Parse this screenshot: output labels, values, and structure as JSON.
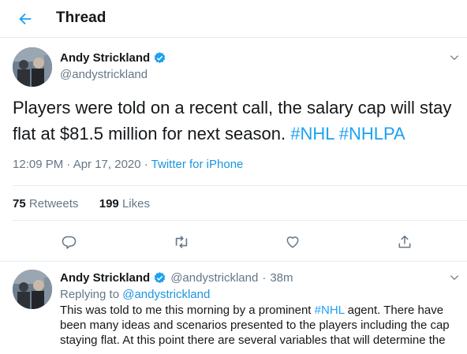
{
  "header": {
    "title": "Thread"
  },
  "main_tweet": {
    "author_name": "Andy Strickland",
    "author_handle": "@andystrickland",
    "text": "Players were told on a recent call, the salary cap will stay flat at $81.5 million for next season. ",
    "hashtags": [
      "#NHL",
      "#NHLPA"
    ],
    "timestamp": "12:09 PM · Apr 17, 2020 · ",
    "source": "Twitter for iPhone",
    "retweets_count": "75",
    "retweets_label": "Retweets",
    "likes_count": "199",
    "likes_label": "Likes"
  },
  "reply_tweet": {
    "author_name": "Andy Strickland",
    "author_handle": "@andystrickland",
    "time_ago": "38m",
    "replying_label": "Replying to",
    "replying_to": "@andystrickland",
    "text_before": "This was told to me this morning by a prominent ",
    "hashtag": "#NHL",
    "text_after": " agent. There have been many ideas and scenarios presented to the players including the cap staying flat. At this point there are several variables that will determine the"
  },
  "icons": {
    "back": "back-arrow-icon",
    "verified": "verified-badge-icon",
    "caret": "chevron-down-icon",
    "reply": "reply-icon",
    "retweet": "retweet-icon",
    "like": "heart-icon",
    "share": "share-icon"
  },
  "colors": {
    "accent": "#1da1f2",
    "text": "#14171a",
    "muted": "#657786",
    "divider": "#e6ecf0"
  }
}
